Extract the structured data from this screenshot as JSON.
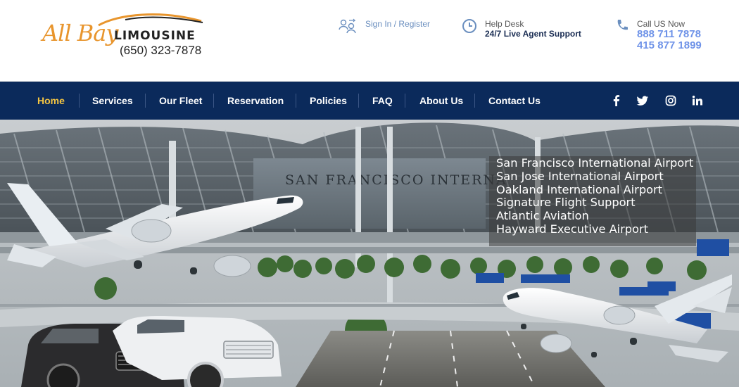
{
  "brand": {
    "name_script": "All Bay",
    "name_word": "LIMOUSINE",
    "phone": "(650) 323-7878"
  },
  "header": {
    "signin_label": "Sign In / Register",
    "help_title": "Help Desk",
    "help_sub": "24/7 Live Agent Support",
    "call_title": "Call US Now",
    "call_number_1": "888 711 7878",
    "call_number_2": "415 877 1899"
  },
  "nav": {
    "items": [
      {
        "label": "Home",
        "active": true
      },
      {
        "label": "Services"
      },
      {
        "label": "Our Fleet"
      },
      {
        "label": "Reservation"
      },
      {
        "label": "Policies"
      },
      {
        "label": "FAQ"
      },
      {
        "label": "About Us"
      },
      {
        "label": "Contact Us"
      }
    ],
    "social": [
      "facebook-icon",
      "twitter-icon",
      "instagram-icon",
      "linkedin-icon"
    ]
  },
  "hero": {
    "building_sign": "SAN FRANCISCO INTERNA",
    "airports": [
      "San Francisco International Airport",
      "San Jose International Airport",
      "Oakland International Airport",
      "Signature Flight Support",
      "Atlantic Aviation",
      "Hayward Executive Airport"
    ]
  },
  "colors": {
    "brand_orange": "#e8952d",
    "nav_bg": "#0b2a5b",
    "nav_active": "#f5c542",
    "phone_blue": "#6f93e8",
    "help_dark": "#1a2d53"
  }
}
